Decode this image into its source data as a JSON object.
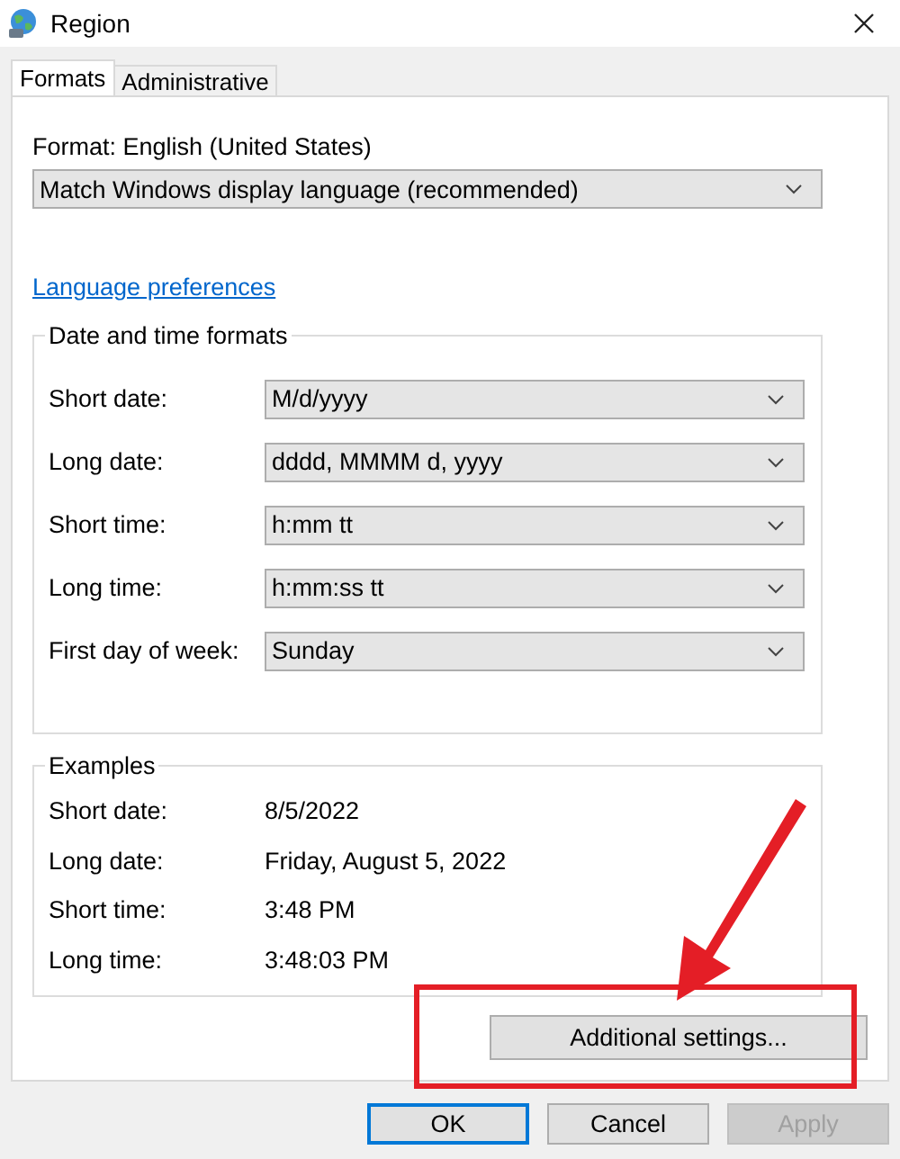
{
  "window": {
    "title": "Region"
  },
  "tabs": [
    {
      "label": "Formats",
      "selected": true
    },
    {
      "label": "Administrative",
      "selected": false
    }
  ],
  "format": {
    "label": "Format: English (United States)",
    "value": "Match Windows display language (recommended)"
  },
  "link": "Language preferences",
  "date_time_formats": {
    "title": "Date and time formats",
    "fields": [
      {
        "label": "Short date:",
        "value": "M/d/yyyy"
      },
      {
        "label": "Long date:",
        "value": "dddd, MMMM d, yyyy"
      },
      {
        "label": "Short time:",
        "value": "h:mm tt"
      },
      {
        "label": "Long time:",
        "value": "h:mm:ss tt"
      },
      {
        "label": "First day of week:",
        "value": "Sunday"
      }
    ]
  },
  "examples": {
    "title": "Examples",
    "rows": [
      {
        "label": "Short date:",
        "value": "8/5/2022"
      },
      {
        "label": "Long date:",
        "value": "Friday, August 5, 2022"
      },
      {
        "label": "Short time:",
        "value": "3:48 PM"
      },
      {
        "label": "Long time:",
        "value": "3:48:03 PM"
      }
    ]
  },
  "additional_button": "Additional settings...",
  "buttons": [
    {
      "label": "OK",
      "default": true,
      "disabled": false
    },
    {
      "label": "Cancel",
      "default": false,
      "disabled": false
    },
    {
      "label": "Apply",
      "default": false,
      "disabled": true
    }
  ]
}
